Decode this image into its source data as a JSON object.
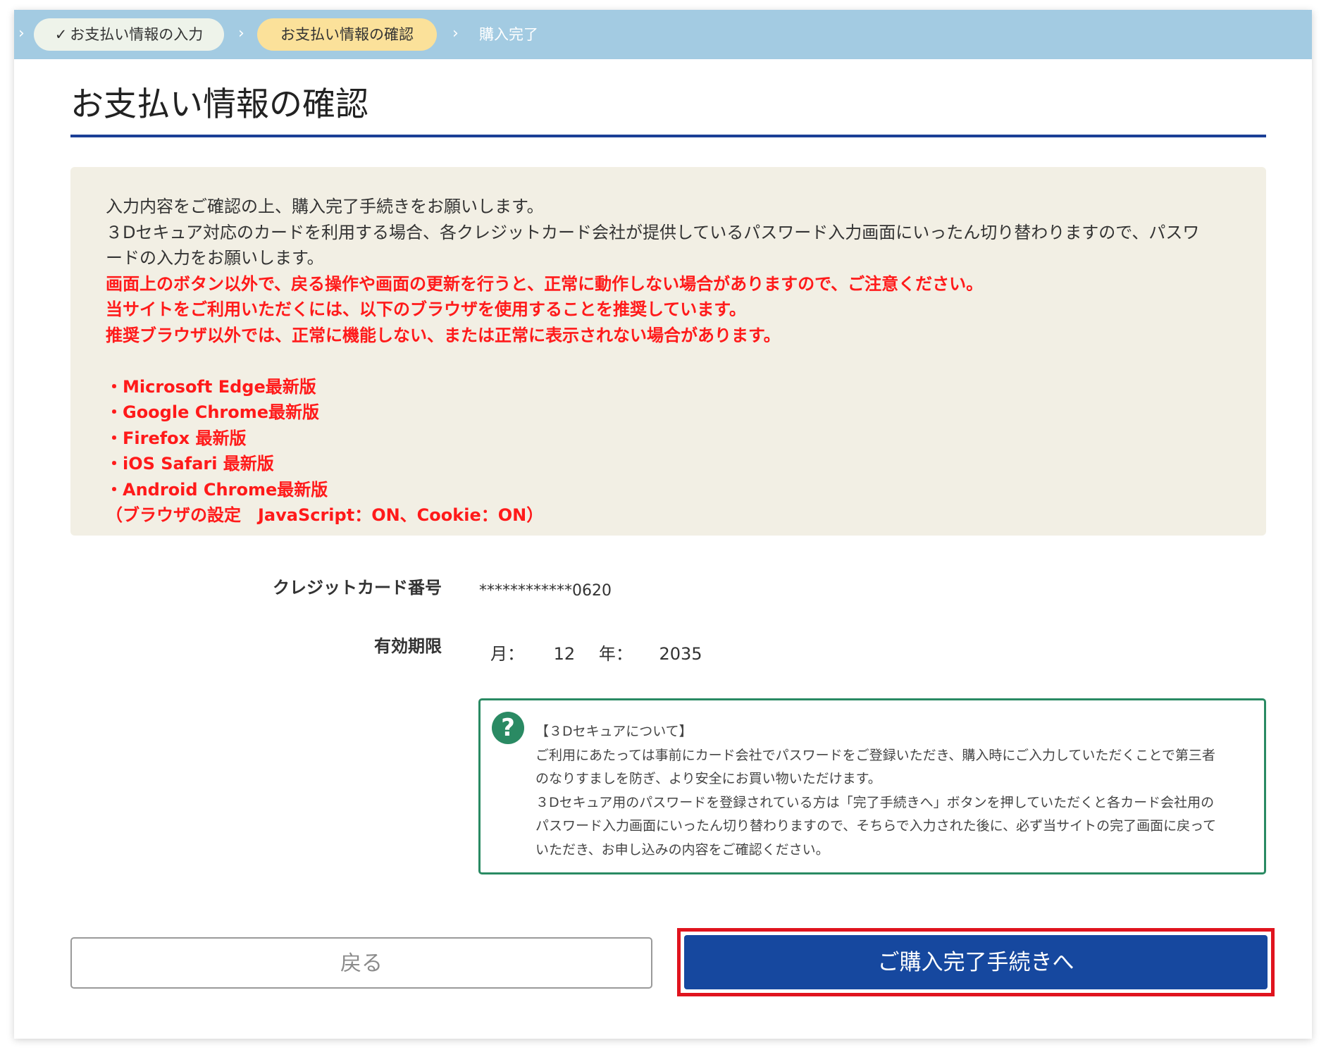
{
  "breadcrumb": {
    "steps": [
      {
        "label": "お支払い情報の入力",
        "state": "done"
      },
      {
        "label": "お支払い情報の確認",
        "state": "current"
      },
      {
        "label": "購入完了",
        "state": "todo"
      }
    ],
    "check_glyph": "✓",
    "chevron_glyph": "›"
  },
  "page_title": "お支払い情報の確認",
  "notice": {
    "lines": [
      "入力内容をご確認の上、購入完了手続きをお願いします。",
      "３Dセキュア対応のカードを利用する場合、各クレジットカード会社が提供しているパスワード入力画面にいったん切り替わりますので、パスワ",
      "ードの入力をお願いします。"
    ],
    "warnings": [
      "画面上のボタン以外で、戻る操作や画面の更新を行うと、正常に動作しない場合がありますので、ご注意ください。",
      "当サイトをご利用いただくには、以下のブラウザを使用することを推奨しています。",
      "推奨ブラウザ以外では、正常に機能しない、または正常に表示されない場合があります。"
    ],
    "browsers": [
      "・Microsoft Edge最新版",
      "・Google Chrome最新版",
      "・Firefox 最新版",
      "・iOS Safari 最新版",
      "・Android Chrome最新版",
      "（ブラウザの設定　JavaScript：ON、Cookie：ON）"
    ]
  },
  "card": {
    "number_label": "クレジットカード番号",
    "number_value": "************0620",
    "expiry_label": "有効期限",
    "month_label": "月：",
    "month_value": "12",
    "year_label": "年：",
    "year_value": "2035"
  },
  "help": {
    "icon_glyph": "?",
    "lines": [
      "【３Dセキュアについて】",
      "ご利用にあたっては事前にカード会社でパスワードをご登録いただき、購入時にご入力していただくことで第三者",
      "のなりすましを防ぎ、より安全にお買い物いただけます。",
      "３Dセキュア用のパスワードを登録されている方は「完了手続きへ」ボタンを押していただくと各カード会社用の",
      "パスワード入力画面にいったん切り替わりますので、そちらで入力された後に、必ず当サイトの完了画面に戻って",
      "いただき、お申し込みの内容をご確認ください。"
    ]
  },
  "buttons": {
    "back_label": "戻る",
    "complete_label": "ご購入完了手続きへ"
  },
  "colors": {
    "breadcrumb_bar": "#a3cbe2",
    "current_step": "#fbe19a",
    "title_underline": "#1b3f96",
    "warning_text": "#ff1a1a",
    "help_border": "#2a8a63",
    "primary_button": "#16489f",
    "highlight_frame": "#e0141e"
  }
}
